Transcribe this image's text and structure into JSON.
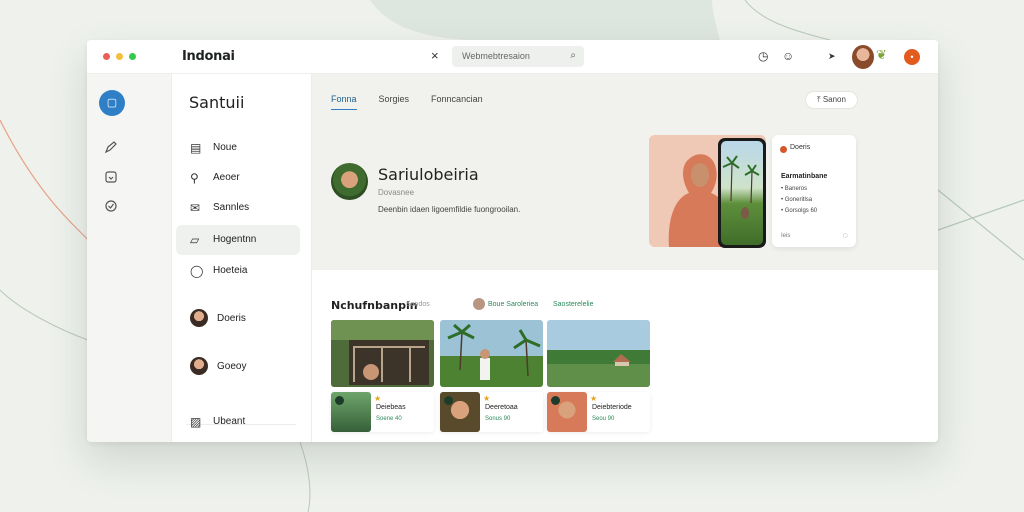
{
  "window": {
    "title": "Indonai"
  },
  "titlebar": {
    "search_text": "Webmebtresaion",
    "close_glyph": "×",
    "search_glyph": "⌕",
    "icon_clock": "◷",
    "icon_smile": "☺",
    "icon_arrow": "➤",
    "leaf_glyph": "❦",
    "notif_glyph": "•"
  },
  "rail": {
    "home_glyph": "▢"
  },
  "sidebar": {
    "title": "Santuii",
    "items": [
      {
        "label": "Noue",
        "icon": "file-icon",
        "glyph": "▤"
      },
      {
        "label": "Aeoer",
        "icon": "search-icon",
        "glyph": "⚲"
      },
      {
        "label": "Sannles",
        "icon": "mail-icon",
        "glyph": "✉"
      },
      {
        "label": "Hogentnn",
        "icon": "edit-icon",
        "glyph": "▱"
      },
      {
        "label": "Hoeteia",
        "icon": "circle-icon",
        "glyph": "◯"
      }
    ],
    "people": [
      {
        "label": "Doeris"
      },
      {
        "label": "Goeoy"
      }
    ],
    "footer": {
      "label": "Ubeant",
      "glyph": "▨"
    }
  },
  "main": {
    "tabs": [
      {
        "label": "Fonna",
        "active": true
      },
      {
        "label": "Sorgies",
        "active": false
      },
      {
        "label": "Fonncancian",
        "active": false
      }
    ],
    "share": {
      "label": "Sanon",
      "glyph": "⤒"
    },
    "profile": {
      "name": "Sariulobeiria",
      "sub": "Dovasnee",
      "desc": "Deenbin idaen ligoemfildie fuongrooilan."
    },
    "info_card": {
      "title": "Doeris",
      "heading": "Earmatinbane",
      "lines": [
        "• Baneros",
        "• Goneritlsa",
        "• Gorsolgs 60"
      ],
      "footer": "Ieis",
      "chat_glyph": "◌"
    },
    "section": {
      "title": "Nchufnbanpin",
      "hint": "Sondos",
      "link1": "Boue Saroleriea",
      "link2": "Saosterelelie"
    },
    "cards": [
      {
        "name": "Deiebeas",
        "meta": "Soene 40",
        "star": "★",
        "badge": "●"
      },
      {
        "name": "Deeretoaa",
        "meta": "Sonus 90",
        "star": "★",
        "badge": "●"
      },
      {
        "name": "Deiebteriode",
        "meta": "Seou 90",
        "star": "★",
        "badge": "●"
      }
    ]
  },
  "colors": {
    "accent": "#2f7fc7",
    "brand_green": "#2c8a5c",
    "notification": "#e35a1f",
    "traffic_red": "#ec5f57",
    "traffic_yellow": "#f4bf3c",
    "traffic_green": "#35c94a"
  }
}
